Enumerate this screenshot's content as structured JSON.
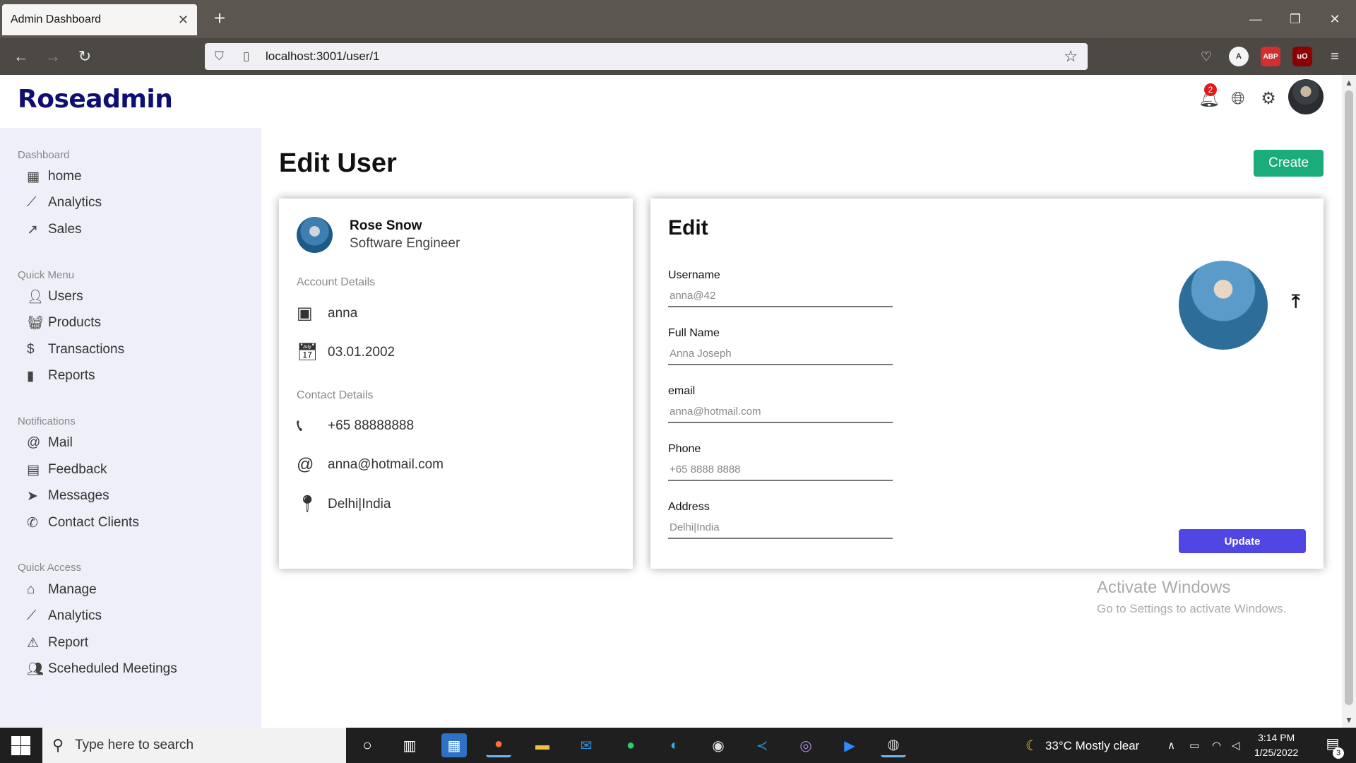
{
  "browser": {
    "tab_title": "Admin Dashboard",
    "url": "localhost:3001/user/1"
  },
  "app": {
    "logo": "Roseadmin",
    "notification_count": "2"
  },
  "sidebar": {
    "sections": [
      {
        "title": "Dashboard",
        "items": [
          {
            "label": "home",
            "icon": "table-icon"
          },
          {
            "label": "Analytics",
            "icon": "timeline-icon"
          },
          {
            "label": "Sales",
            "icon": "trending-up-icon"
          }
        ]
      },
      {
        "title": "Quick Menu",
        "items": [
          {
            "label": "Users",
            "icon": "person-icon"
          },
          {
            "label": "Products",
            "icon": "basket-icon"
          },
          {
            "label": "Transactions",
            "icon": "dollar-icon"
          },
          {
            "label": "Reports",
            "icon": "bar-chart-icon"
          }
        ]
      },
      {
        "title": "Notifications",
        "items": [
          {
            "label": "Mail",
            "icon": "at-icon"
          },
          {
            "label": "Feedback",
            "icon": "chat-icon"
          },
          {
            "label": "Messages",
            "icon": "send-icon"
          },
          {
            "label": "Contact Clients",
            "icon": "whatsapp-icon"
          }
        ]
      },
      {
        "title": "Quick Access",
        "items": [
          {
            "label": "Manage",
            "icon": "manage-icon"
          },
          {
            "label": "Analytics",
            "icon": "timeline-icon"
          },
          {
            "label": "Report",
            "icon": "warning-icon"
          },
          {
            "label": "Sceheduled Meetings",
            "icon": "group-icon"
          }
        ]
      }
    ]
  },
  "main": {
    "title": "Edit User",
    "create_label": "Create"
  },
  "user_show": {
    "name": "Rose Snow",
    "job": "Software Engineer",
    "account_title": "Account Details",
    "username": "anna",
    "birthday": "03.01.2002",
    "contact_title": "Contact Details",
    "phone": "+65 88888888",
    "email": "anna@hotmail.com",
    "address": "Delhi|India"
  },
  "user_update": {
    "title": "Edit",
    "fields": [
      {
        "label": "Username",
        "placeholder": "anna@42"
      },
      {
        "label": "Full Name",
        "placeholder": "Anna Joseph"
      },
      {
        "label": "email",
        "placeholder": "anna@hotmail.com"
      },
      {
        "label": "Phone",
        "placeholder": "+65 8888 8888"
      },
      {
        "label": "Address",
        "placeholder": "Delhi|India"
      }
    ],
    "update_label": "Update"
  },
  "watermark": {
    "line1": "Activate Windows",
    "line2": "Go to Settings to activate Windows."
  },
  "taskbar": {
    "search_placeholder": "Type here to search",
    "weather": "33°C  Mostly clear",
    "time": "3:14 PM",
    "date": "1/25/2022",
    "notification_count": "3"
  }
}
